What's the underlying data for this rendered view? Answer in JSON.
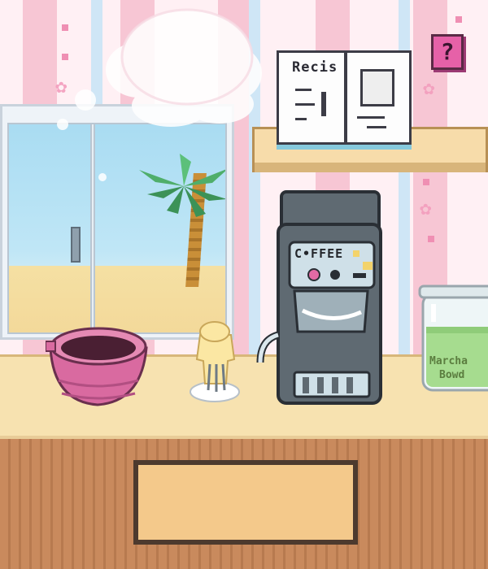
{
  "scene": {
    "help_button_label": "?",
    "recipe_book_title": "Recis",
    "coffee_machine_label": "C•FFEE",
    "jar_label_line1": "Marcha",
    "jar_label_line2": "Bowd"
  },
  "colors": {
    "wall_pink": "#f7c6d4",
    "help_button": "#e661a8",
    "counter_top": "#f7e2b0",
    "counter_wood": "#c98a5d",
    "coffee_machine": "#5f6a72",
    "matcha_green": "#a6dc8f"
  }
}
